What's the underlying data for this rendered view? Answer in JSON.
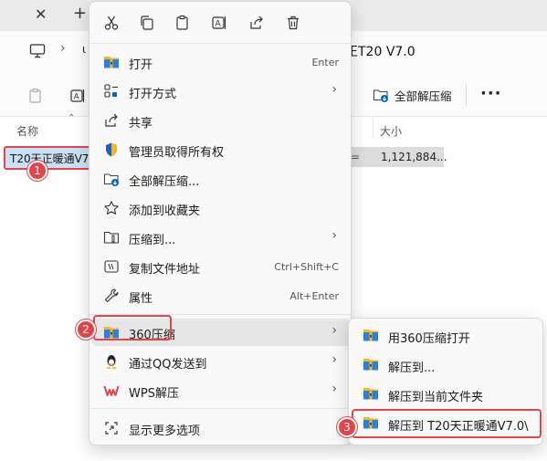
{
  "explorer": {
    "tab_close": "✕",
    "tab_add": "+",
    "address_partial": "ι",
    "address_text": "正T20 V7.0",
    "toolbar_extract_all": "全部解压缩",
    "toolbar_more": "···",
    "column_name": "名称",
    "column_size": "大小",
    "file_name": "T20天正暖通V7.0",
    "file_type_partial": "=",
    "file_size": "1,121,884..."
  },
  "context_menu": {
    "actions": [
      "cut-icon",
      "copy-icon",
      "paste-icon",
      "rename-icon",
      "share-icon",
      "delete-icon"
    ],
    "items": [
      {
        "label": "打开",
        "shortcut": "Enter",
        "icon": "archive-icon"
      },
      {
        "label": "打开方式",
        "arrow": "›",
        "icon": "open-with-icon"
      },
      {
        "label": "共享",
        "icon": "share-icon"
      },
      {
        "label": "管理员取得所有权",
        "icon": "shield-icon"
      },
      {
        "label": "全部解压缩...",
        "icon": "extract-all-icon"
      },
      {
        "label": "添加到收藏夹",
        "icon": "star-icon"
      },
      {
        "label": "压缩到...",
        "arrow": "›",
        "icon": "compress-icon"
      },
      {
        "label": "复制文件地址",
        "shortcut": "Ctrl+Shift+C",
        "icon": "copy-path-icon"
      },
      {
        "label": "属性",
        "shortcut": "Alt+Enter",
        "icon": "wrench-icon"
      },
      {
        "label": "360压缩",
        "arrow": "›",
        "icon": "archive-icon"
      },
      {
        "label": "通过QQ发送到",
        "arrow": "›",
        "icon": "qq-icon"
      },
      {
        "label": "WPS解压",
        "arrow": "›",
        "icon": "wps-icon"
      },
      {
        "label": "显示更多选项",
        "icon": "more-options-icon"
      }
    ]
  },
  "submenu": {
    "items": [
      {
        "label": "用360压缩打开"
      },
      {
        "label": "解压到..."
      },
      {
        "label": "解压到当前文件夹"
      },
      {
        "label": "解压到 T20天正暖通V7.0\\"
      }
    ]
  },
  "badges": [
    "1",
    "2",
    "3"
  ],
  "colors": {
    "highlight_red": "#e0454b",
    "accent_blue": "#0067c0",
    "archive_yellow": "#f2b824"
  }
}
